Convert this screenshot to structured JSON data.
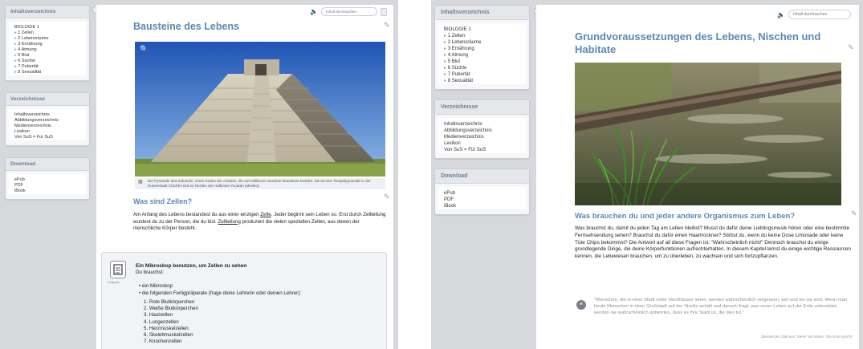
{
  "left": {
    "toc_title": "Inhaltsverzeichnis",
    "toc_items": [
      "BIOLOGIE 1",
      "1 Zellen",
      "2 Lebensräume",
      "3 Ernährung",
      "4 Atmung",
      "5 Blut",
      "6 Süchte",
      "7 Pubertät",
      "8 Sexualität"
    ],
    "lists_title": "Verzeichnisse",
    "lists_items": [
      "Inhaltsverzeichnis",
      "Abbildungsverzeichnis",
      "Medienverzeichnis",
      "Lexikon",
      "Von SuS = Für SuS"
    ],
    "download_title": "Download",
    "download_items": [
      "ePub",
      "PDF",
      "iBook"
    ],
    "search_placeholder": "Inhalt durchsuchen",
    "heading": "Bausteine des Lebens",
    "caption": "Die Pyramide des Kukulcán, eines Gottes der Azteken, die aus Millionen einzelner Bausteine besteht. Sie ist eine Tempelpyramide in der Ruinenstadt Chichén Itzá im Norden der Halbinsel Yucatán (Mexiko).",
    "subheading": "Was sind Zellen?",
    "para_1": "Am Anfang des Lebens bestandest du aus einer einzigen",
    "para_link_1": "Zelle",
    "para_2": ". Jeder beginnt sein Leben so. Erst durch Zellteilung wurdest du zu der Person, die du bist.",
    "para_link_2": "Zellteilung",
    "para_3": "produziert die vielen speziellen Zellen, aus denen der menschliche Körper besteht.",
    "box_icon_label": "Aufgabe",
    "box_title": "Ein Mikroskop benutzen, um Zellen zu sehen",
    "box_intro": "Du brauchst:",
    "box_bullets": [
      "ein Mikroskop",
      "die folgenden Fertigpräparate (frage deine Lehrerin oder deinen Lehrer):"
    ],
    "box_numbered": [
      "1. Rote Blutkörperchen",
      "2. Weiße Blutkörperchen",
      "3. Hautzellen",
      "4. Lungenzellen",
      "5. Herzmuskelzellen",
      "6. Skelettmuskelzellen",
      "7. Knochenzellen"
    ]
  },
  "right": {
    "toc_title": "Inhaltsverzeichnis",
    "toc_items": [
      "BIOLOGIE 1",
      "1 Zellen",
      "2 Lebensräume",
      "3 Ernährung",
      "4 Atmung",
      "5 Blut",
      "6 Süchte",
      "7 Pubertät",
      "8 Sexualität"
    ],
    "lists_title": "Verzeichnisse",
    "lists_items": [
      "Inhaltsverzeichnis",
      "Abbildungsverzeichnis",
      "Medienverzeichnis",
      "Lexikon",
      "Von SuS = Für SuS"
    ],
    "download_title": "Download",
    "download_items": [
      "ePub",
      "PDF",
      "iBook"
    ],
    "search_placeholder": "Inhalt durchsuchen",
    "heading": "Grundvoraussetzungen des Lebens, Nischen und Habitate",
    "subheading": "Was brauchen du und jeder andere Organismus zum Leben?",
    "paragraph": "Was brauchst du, damit du jeden Tag am Leben bleibst? Musst du dafür deine Lieblingsmusik hören oder eine bestimmte Fernsehsendung sehen? Brauchst du dafür einen Haartrockner? Stirbst du, wenn du keine Dose Limonade oder keine Tüte Chips bekommst? Die Antwort auf all diese Fragen ist: \"Wahrscheinlich nicht!\" Dennoch brauchst du einige grundlegende Dinge, die deine Körperfunktionen aufrechterhalten. In diesem Kapitel lernst du einige wichtige Ressourcen kennen, die Lebewesen brauchen, um zu überleben, zu wachsen und sich fortzupflanzen.",
    "quote": "\"Menschen, die in einer Stadt voller Hochhäuser leben, werden wahrscheinlich vergessen, wer und wo sie sind. Wenn man heute Menschen in einer Großstadt auf der Straße anhält und danach fragt, was unser Leben auf der Erde unterstützt, werden sie wahrscheinlich antworten, dass es ihre Stadt ist, die dies tut.\"",
    "quote_source": "Übersetztes Zitat aus: Steve Van Matre, 'Die Erde spricht'"
  }
}
